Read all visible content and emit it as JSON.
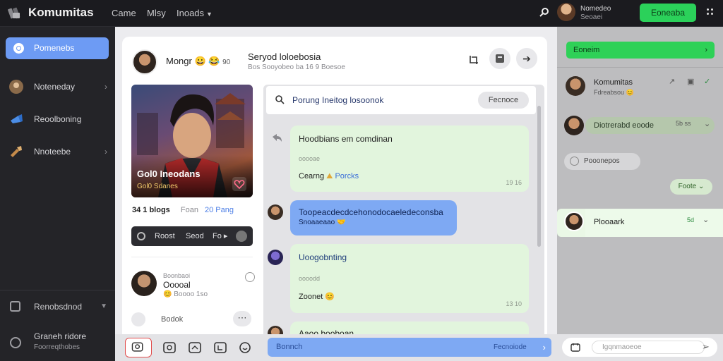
{
  "app": {
    "brand": "Komumitas",
    "nav": [
      "Came",
      "Mlsy",
      "Inoads"
    ],
    "top_user": {
      "name": "Nomedeo",
      "sub": "Seoaei"
    },
    "cta_label": "Eoneaba"
  },
  "sidebar": {
    "active_label": "Pomenebs",
    "items": [
      {
        "label": "Noteneday"
      },
      {
        "label": "Reoolboning"
      },
      {
        "label": "Nnoteebe"
      }
    ],
    "bottom1": "Renobsdnod",
    "bottom2": {
      "line1": "Graneh ridore",
      "line2": "Foorreqthobes"
    }
  },
  "thread": {
    "name": "Mongr",
    "name_emoji": "😀 😂",
    "name_count": "90",
    "title": "Seryod loloebosia",
    "subtitle": "Bos Sooyobeo ba 16 9 Boesoe"
  },
  "hero": {
    "name": "Gol0 Ineodans",
    "meta": "Gol0 Sdanes"
  },
  "stats": {
    "count": "34 1 blogs",
    "mid": "Foan",
    "link": "20 Pang"
  },
  "dark_bar": {
    "t1": "Roost",
    "t2": "Seod",
    "t3": "Fo ▸"
  },
  "mini_profile": {
    "l1": "Boonbaoi",
    "l2": "Ooooal",
    "l3": "Boooo 1so",
    "foot": "Bodok"
  },
  "chat": {
    "search_text": "Porung Ineitog losoonok",
    "search_btn": "Fecnoce",
    "messages": [
      {
        "text": "Hoodbians em comdinan",
        "small": "ooooae",
        "footer": "Cearng",
        "link": "Porcks",
        "time": "19 16"
      },
      {
        "text": "Toopeacdecdcehonodocaeledeconsba",
        "small": "Snoaaeaao"
      },
      {
        "text": "Uoogobnting",
        "small": "oooodd",
        "footer": "Zoonet",
        "time": "13 10"
      },
      {
        "text": "Aaoo booboan"
      }
    ]
  },
  "right": {
    "green_label": "Eoneim",
    "rows": [
      {
        "name": "Komumitas",
        "sub": "Fdreabsou"
      },
      {
        "name": "Diotrerabd eoode",
        "badge": "5b ss"
      },
      {
        "name": "Pooonepos"
      },
      {
        "name": "Foote"
      },
      {
        "name": "Plooaark",
        "badge": "5d"
      }
    ]
  },
  "bottom": {
    "input_label": "Bonnch",
    "input_placeholder": "Fecnoiode",
    "right_placeholder": "Igqnmaoeoe"
  },
  "colors": {
    "accent_blue": "#7ea9f3",
    "accent_green": "#2bd15a",
    "dark": "#1b1b1f"
  }
}
